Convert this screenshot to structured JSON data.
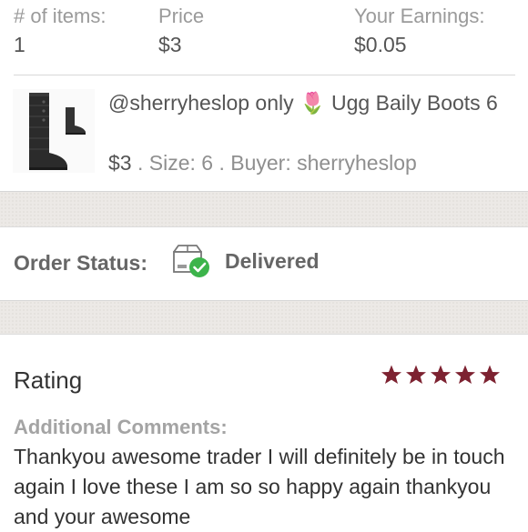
{
  "summary": {
    "items_label": "# of items:",
    "items_value": "1",
    "price_label": "Price",
    "price_value": "$3",
    "earnings_label": "Your Earnings:",
    "earnings_value": "$0.05"
  },
  "listing": {
    "title": "@sherryheslop only 🌷 Ugg Baily Boots 6",
    "price": "$3",
    "meta": " . Size: 6 . Buyer: sherryheslop",
    "thumbnail_icon": "boots-thumbnail"
  },
  "status": {
    "label": "Order Status:",
    "value": "Delivered",
    "icon": "delivered-box-icon",
    "check_color": "#3cb44b"
  },
  "rating": {
    "title": "Rating",
    "stars": 5,
    "max_stars": 5,
    "star_color": "#7d2231",
    "comments_label": "Additional Comments:",
    "comments_text": "Thankyou awesome trader I will definitely be in touch again I love these I am so so happy again thankyou and your awesome"
  }
}
